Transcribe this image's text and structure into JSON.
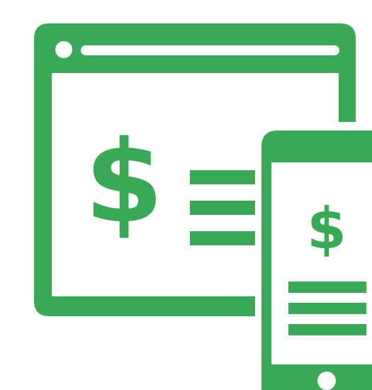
{
  "browser_window": {
    "currency_symbol": "$"
  },
  "phone": {
    "currency_symbol": "$"
  },
  "colors": {
    "accent": "#39A957",
    "background": "#FFFFFF"
  },
  "icons": {
    "browser": "browser-window-icon",
    "phone": "smartphone-icon",
    "list_lines": "text-lines-icon"
  }
}
